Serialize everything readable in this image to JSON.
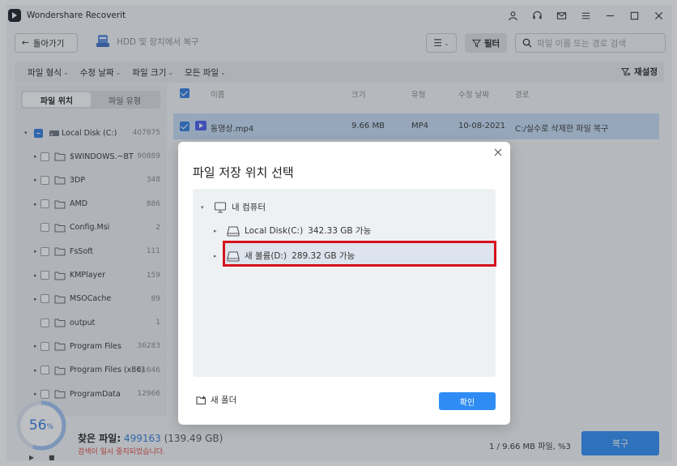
{
  "app": {
    "title": "Wondershare Recoverit"
  },
  "nav": {
    "back_label": "돌아가기",
    "location": "HDD 및 장치에서 복구",
    "filter_label": "필터",
    "search_placeholder": "파일 이름 또는 경로 검색"
  },
  "filters": {
    "items": [
      "파일 형식",
      "수정 날짜",
      "파일 크기",
      "모든 파일"
    ],
    "reset_label": "재설정"
  },
  "sidebar": {
    "tabs": [
      "파일 위치",
      "파일 유형"
    ],
    "root": {
      "name": "Local Disk (C:)",
      "count": "407875"
    },
    "items": [
      {
        "name": "$WINDOWS.~BT",
        "count": "90889"
      },
      {
        "name": "3DP",
        "count": "348"
      },
      {
        "name": "AMD",
        "count": "886"
      },
      {
        "name": "Config.Msi",
        "count": "2"
      },
      {
        "name": "FsSoft",
        "count": "111"
      },
      {
        "name": "KMPlayer",
        "count": "159"
      },
      {
        "name": "MSOCache",
        "count": "89"
      },
      {
        "name": "output",
        "count": "1"
      },
      {
        "name": "Program Files",
        "count": "36283"
      },
      {
        "name": "Program Files (x86)",
        "count": "41646"
      },
      {
        "name": "ProgramData",
        "count": "12966"
      }
    ]
  },
  "table": {
    "headers": {
      "name": "이름",
      "size": "크기",
      "type": "유형",
      "date": "수정 날짜",
      "path": "경로"
    },
    "rows": [
      {
        "name": "동영상.mp4",
        "size": "9.66 MB",
        "type": "MP4",
        "date": "10-08-2021",
        "path": "C:/실수로 삭제한 파일 복구"
      }
    ]
  },
  "bottom": {
    "progress": "56",
    "progress_unit": "%",
    "found_label": "찾은 파일:",
    "found_count": "499163",
    "found_size": "(139.49 GB)",
    "paused_text": "검색이 일시 중지되었습니다.",
    "stats": "1 / 9.66 MB 파일, %3",
    "recover_label": "복구"
  },
  "dialog": {
    "title": "파일 저장 위치 선택",
    "tree": {
      "root": "내 컴퓨터",
      "drives": [
        {
          "name": "Local Disk(C:)",
          "free": "342.33 GB 가능"
        },
        {
          "name": "새 볼륨(D:)",
          "free": "289.32 GB 가능"
        }
      ]
    },
    "new_folder_label": "새 폴더",
    "ok_label": "확인"
  },
  "colors": {
    "accent": "#2f8cf5",
    "highlight_border": "#d5121b",
    "paused": "#e0453b"
  }
}
